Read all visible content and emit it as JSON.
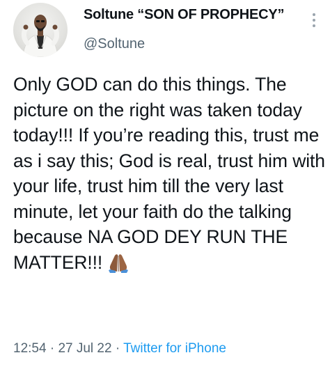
{
  "tweet": {
    "display_name": "Soltune “SON OF PROPHECY”",
    "handle": "@Soltune",
    "text": "Only GOD can do this things. The picture on the right was taken today today!!! If you’re reading this, trust me as i say this; God is real, trust him with your life, trust him till the very last minute, let your faith do the talking because NA GOD DEY RUN THE MATTER!!!",
    "emoji": "folded-hands-emoji",
    "time": "12:54",
    "date": "27 Jul 22",
    "separator": "·",
    "source": "Twitter for iPhone"
  },
  "icons": {
    "more": "more-vertical-icon",
    "avatar": "user-avatar-photo"
  },
  "colors": {
    "text": "#0f1419",
    "secondary": "#536471",
    "link": "#1d9bf0",
    "background": "#ffffff"
  }
}
